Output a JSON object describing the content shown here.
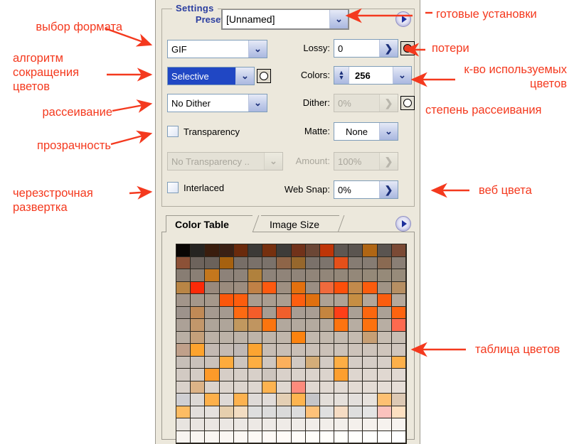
{
  "panel": {
    "preset": {
      "label": "Preset:",
      "value": "[Unnamed]",
      "flyout_icon": "triangle-right-icon"
    },
    "settings_legend": "Settings",
    "format": {
      "value": "GIF"
    },
    "reduction": {
      "value": "Selective"
    },
    "dither_algorithm": {
      "value": "No Dither"
    },
    "lossy": {
      "label": "Lossy:",
      "value": "0"
    },
    "colors": {
      "label": "Colors:",
      "value": "256"
    },
    "dither": {
      "label": "Dither:",
      "value": "0%",
      "disabled": true
    },
    "transparency": {
      "label": "Transparency",
      "checked": false
    },
    "matte": {
      "label": "Matte:",
      "value": "None"
    },
    "transparency_dither": {
      "value": "No Transparency ..",
      "disabled": true
    },
    "amount": {
      "label": "Amount:",
      "value": "100%",
      "disabled": true
    },
    "interlaced": {
      "label": "Interlaced",
      "checked": false
    },
    "web_snap": {
      "label": "Web Snap:",
      "value": "0%"
    }
  },
  "color_table": {
    "tabs": [
      {
        "label": "Color Table",
        "active": true
      },
      {
        "label": "Image Size",
        "active": false
      }
    ],
    "flyout_icon": "triangle-right-icon",
    "swatch_count": 256,
    "columns": 16,
    "swatches": [
      "#0a0604",
      "#262421",
      "#3a1d0d",
      "#3b2014",
      "#6a2a0c",
      "#3c3a37",
      "#76300f",
      "#3e3c39",
      "#71321a",
      "#6b4635",
      "#bf3508",
      "#5e5752",
      "#5b5550",
      "#b06614",
      "#5a5450",
      "#7b4a35",
      "#8c5137",
      "#6d635c",
      "#6b625b",
      "#a6610f",
      "#776e67",
      "#7a716a",
      "#7b726b",
      "#8e6548",
      "#96672c",
      "#7a716a",
      "#7d746d",
      "#e5501a",
      "#867c73",
      "#867c73",
      "#8a6a52",
      "#8a7f75",
      "#887d73",
      "#8a7f75",
      "#c4771d",
      "#8d8279",
      "#8e8379",
      "#b0813d",
      "#8e8379",
      "#908479",
      "#908479",
      "#918579",
      "#928679",
      "#938779",
      "#948879",
      "#958978",
      "#968a79",
      "#978b7a",
      "#b98545",
      "#fc2a08",
      "#99897c",
      "#9a8b7d",
      "#9c8d7f",
      "#c08146",
      "#fd5a10",
      "#9e8f81",
      "#e3700f",
      "#9b8e83",
      "#f06a3d",
      "#fd4f0a",
      "#c28a4c",
      "#fb5c0d",
      "#a09385",
      "#b68f63",
      "#a2958a",
      "#a4978a",
      "#a5988b",
      "#fb570b",
      "#fd5d0d",
      "#a99c8f",
      "#aa9d90",
      "#ab9e91",
      "#fd5e0f",
      "#e0700f",
      "#aea194",
      "#afa295",
      "#c68e43",
      "#b3a699",
      "#fb5d0e",
      "#b5a89b",
      "#9d938c",
      "#c08a56",
      "#a59a90",
      "#a59a90",
      "#fd6a12",
      "#f45d2a",
      "#a79c92",
      "#f05f2c",
      "#a89d93",
      "#a99e94",
      "#c5853f",
      "#fe3f18",
      "#aaa095",
      "#fb670f",
      "#aba196",
      "#fd6410",
      "#aca197",
      "#c2976b",
      "#aea499",
      "#afa59a",
      "#c1985f",
      "#c09560",
      "#fb750f",
      "#b2a89d",
      "#b3a99e",
      "#b4aa9f",
      "#b5aba0",
      "#fd7410",
      "#b7ada2",
      "#fc720f",
      "#b8aea3",
      "#fc6a4f",
      "#b9afa4",
      "#c4a07a",
      "#bbb1a6",
      "#bcb2a7",
      "#bdb3a8",
      "#beb4a9",
      "#bfb5aa",
      "#c0b6ab",
      "#fc830f",
      "#c2b8ad",
      "#c3b9ae",
      "#c4baaf",
      "#c5bbb0",
      "#c79f74",
      "#c7bdb2",
      "#c8beb3",
      "#c0a08a",
      "#fda32d",
      "#c3b9b2",
      "#c4bab3",
      "#c0b8b4",
      "#fca431",
      "#c7bdb4",
      "#c8beb5",
      "#c9bfb6",
      "#cac0b7",
      "#cbc1b8",
      "#ccc2b9",
      "#cdc3ba",
      "#cec4bb",
      "#cfc5bc",
      "#d0c6bd",
      "#c7bfb8",
      "#c9c1ba",
      "#cac2bb",
      "#fdab3d",
      "#cdc5be",
      "#fdae42",
      "#cfc7c0",
      "#fcb05c",
      "#d1c9c2",
      "#d4ad79",
      "#d3cbc4",
      "#fdae45",
      "#d5cdc6",
      "#d6cec7",
      "#d7cfc8",
      "#fdb04a",
      "#d2cac3",
      "#d4ccc5",
      "#fd9a2a",
      "#d6cec7",
      "#d7cfc8",
      "#d8d0c9",
      "#cdc5be",
      "#d9d1ca",
      "#dad2cb",
      "#dbd3cc",
      "#dcd4cd",
      "#fd9f2f",
      "#ded6cf",
      "#dfd7d0",
      "#e0d8d1",
      "#e1d9d2",
      "#d9d1ca",
      "#dcb387",
      "#dbd3cc",
      "#dcd4cd",
      "#ddd5ce",
      "#ded6cf",
      "#fdb350",
      "#dfd7d0",
      "#fc8b7c",
      "#e0d8d1",
      "#e1d9d2",
      "#e2dad3",
      "#e3dbd4",
      "#e4dcd5",
      "#e5ddd6",
      "#e6ded7",
      "#cfcfd3",
      "#dcd8d5",
      "#fdb04a",
      "#ded9d6",
      "#fdb24f",
      "#dfdad7",
      "#e1dcd9",
      "#e4cfb4",
      "#fdb44f",
      "#c5c5c8",
      "#e3ded9",
      "#e5e0db",
      "#e3dfdc",
      "#e7e2dd",
      "#fdc072",
      "#ddc9b4",
      "#fdbc63",
      "#e2dedb",
      "#e5e1de",
      "#e6cfae",
      "#f3ddc2",
      "#dedede",
      "#dcdcdc",
      "#dadada",
      "#dcdcdc",
      "#fdc179",
      "#e0e0e0",
      "#f5dcc4",
      "#dedede",
      "#e4e4e4",
      "#fbc2bd",
      "#fde0c1",
      "#e8e4e0",
      "#e9e5e1",
      "#eae6e2",
      "#ebe7e3",
      "#ece8e4",
      "#ede9e5",
      "#eeeae6",
      "#efebe7",
      "#f0ece8",
      "#f1ede9",
      "#f2eeea",
      "#f3efeb",
      "#f4f0ec",
      "#f5f1ed",
      "#f6f2ee",
      "#f7f3ef",
      "#f8f4f0",
      "#f9f5f1",
      "#faf6f2",
      "#fbf7f3",
      "#fcf8f4",
      "#fdf9f5",
      "#fefaf6",
      "#fffbf7",
      "#fffcf8",
      "#fffdf9",
      "#fffefa",
      "#fffffb",
      "#fffffc",
      "#fffffd",
      "#fffffe",
      "#ffffff"
    ]
  },
  "annotations": {
    "accent_color": "#f4391e",
    "left": [
      {
        "text": "выбор формата"
      },
      {
        "text": "алгоритм\nсокращения\nцветов"
      },
      {
        "text": "рассеивание"
      },
      {
        "text": "прозрачность"
      },
      {
        "text": "черезстрочная\nразвертка"
      }
    ],
    "right": [
      {
        "text": "готовые установки"
      },
      {
        "text": "потери"
      },
      {
        "text": "к-во используемых\nцветов"
      },
      {
        "text": "степень рассеивания"
      },
      {
        "text": "веб цвета"
      },
      {
        "text": "таблица цветов"
      }
    ]
  }
}
